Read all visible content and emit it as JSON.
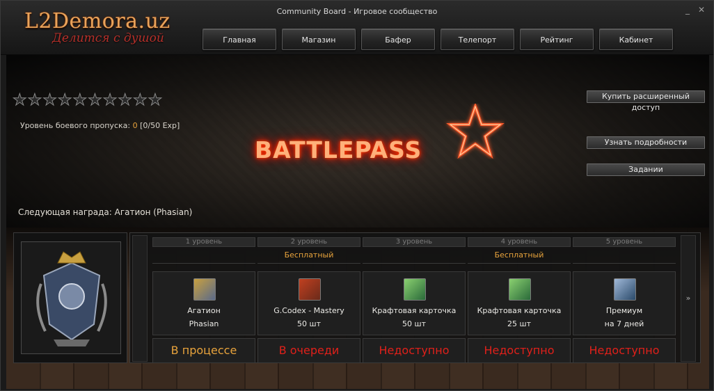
{
  "window": {
    "title": "Community Board - Игровое сообщество",
    "minimize_glyph": "_",
    "close_glyph": "✕"
  },
  "logo": {
    "main": "L2Demora.uz",
    "tagline": "Делится с душой"
  },
  "nav": [
    "Главная",
    "Магазин",
    "Бафер",
    "Телепорт",
    "Рейтинг",
    "Кабинет"
  ],
  "progress": {
    "stars_total": 10,
    "stars_filled": 0,
    "level_label": "Уровень боевого пропуска:",
    "level_value": "0",
    "exp_text": "[0/50 Exp]",
    "next_reward": "Следующая награда: Агатион (Phasian)"
  },
  "banner": {
    "title": "BATTLEPASS"
  },
  "side_buttons": {
    "buy": "Купить расширенный доступ",
    "details": "Узнать подробности",
    "tasks": "Задании"
  },
  "rewards": {
    "next_arrow": "»",
    "columns": [
      {
        "level": "1 уровень",
        "tier": "",
        "icon": "agathion-icon",
        "name": "Агатион",
        "qty": "Phasian",
        "status": "В процессе",
        "status_color": "#e8a33c"
      },
      {
        "level": "2 уровень",
        "tier": "Бесплатный",
        "icon": "codex-book-icon",
        "name": "G.Codex - Mastery",
        "qty": "50 шт",
        "status": "В очереди",
        "status_color": "#e0201a"
      },
      {
        "level": "3 уровень",
        "tier": "",
        "icon": "craft-card-icon",
        "name": "Крафтовая карточка",
        "qty": "50 шт",
        "status": "Недоступно",
        "status_color": "#e0201a"
      },
      {
        "level": "4 уровень",
        "tier": "Бесплатный",
        "icon": "craft-card-icon",
        "name": "Крафтовая карточка",
        "qty": "25 шт",
        "status": "Недоступно",
        "status_color": "#e0201a"
      },
      {
        "level": "5 уровень",
        "tier": "",
        "icon": "premium-icon",
        "name": "Премиум",
        "qty": "на 7 дней",
        "status": "Недоступно",
        "status_color": "#e0201a"
      }
    ]
  },
  "colors": {
    "accent_gold": "#e8a33c",
    "status_red": "#e0201a"
  }
}
